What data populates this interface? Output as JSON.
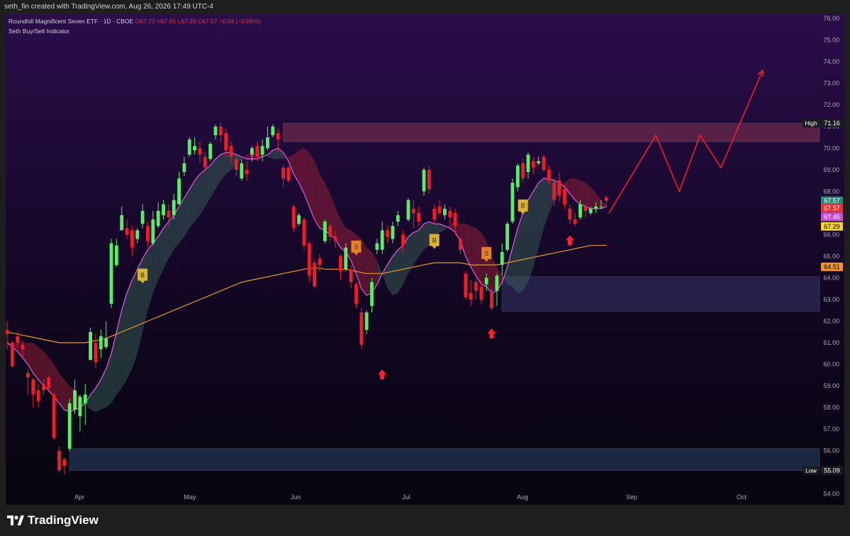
{
  "header": {
    "credit": "seth_fin created with TradingView.com, Aug 26, 2026 17:49 UTC-4"
  },
  "legend": {
    "symbol": "Roundhill Magnificent Seven ETF · 1D · CBOE",
    "ohlc": "O67.73  H67.81  L67.28  C67.57  −0.04 (−0.06%)",
    "indicator": "Seth Buy/Sell Indicator"
  },
  "branding": {
    "logo_text": "TradingView"
  },
  "colors": {
    "bg_top": "#2a0d4a",
    "bg_bottom": "#07060e",
    "up_candle": "#59ee6a",
    "down_candle": "#f01c2a",
    "ma_fast": "#e45ce2",
    "ma_slow": "#e59a2a",
    "projection": "#f01c2a",
    "buy_label": "#d9b23a",
    "sell_label": "#e3802a"
  },
  "chart_data": {
    "type": "candlestick",
    "title": "Roundhill Magnificent Seven ETF · 1D · CBOE",
    "ylim": [
      53.5,
      76.2
    ],
    "y_ticks": [
      "76.00",
      "75.00",
      "74.00",
      "73.00",
      "72.00",
      "71.00",
      "70.00",
      "69.00",
      "68.00",
      "67.00",
      "66.00",
      "65.00",
      "64.00",
      "63.00",
      "62.00",
      "61.00",
      "60.00",
      "59.00",
      "58.00",
      "57.00",
      "56.00",
      "55.00",
      "54.00"
    ],
    "x_labels": [
      "Apr",
      "May",
      "Jun",
      "Jul",
      "Aug",
      "Sep",
      "Oct"
    ],
    "price_tags": [
      {
        "label": "High",
        "value": "71.16",
        "price": 71.16,
        "bg": "#1b1b22",
        "fg": "#ffffff"
      },
      {
        "value": "67.57",
        "price": 67.57,
        "bg": "#2b8a7a",
        "fg": "#ffffff"
      },
      {
        "value": "67.57",
        "price": 67.22,
        "bg": "#e5323a",
        "fg": "#ffffff"
      },
      {
        "value": "67.45",
        "price": 66.82,
        "bg": "#c84fd0",
        "fg": "#ffffff"
      },
      {
        "value": "67.29",
        "price": 66.38,
        "bg": "#f2d33a",
        "fg": "#000000"
      },
      {
        "value": "64.51",
        "price": 64.51,
        "bg": "#f0952a",
        "fg": "#000000"
      },
      {
        "label": "Low",
        "value": "55.09",
        "price": 55.09,
        "bg": "#1b1b22",
        "fg": "#ffffff"
      }
    ],
    "candles": [
      [
        61.6,
        61.4,
        62.0,
        60.7
      ],
      [
        61.0,
        59.9,
        61.1,
        59.9
      ],
      [
        61.3,
        61.0,
        61.5,
        60.8
      ],
      [
        60.9,
        60.7,
        61.1,
        60.3
      ],
      [
        59.6,
        59.4,
        59.8,
        58.6
      ],
      [
        59.3,
        58.6,
        59.4,
        58.0
      ],
      [
        58.8,
        58.3,
        59.1,
        58.0
      ],
      [
        59.1,
        58.8,
        59.3,
        58.6
      ],
      [
        59.4,
        58.9,
        59.5,
        58.7
      ],
      [
        58.6,
        56.6,
        58.7,
        56.5
      ],
      [
        56.0,
        55.1,
        56.2,
        55.0
      ],
      [
        55.6,
        55.3,
        55.7,
        54.9
      ],
      [
        56.1,
        58.2,
        58.4,
        56.0
      ],
      [
        57.9,
        58.8,
        59.3,
        57.7
      ],
      [
        57.6,
        58.5,
        58.6,
        56.9
      ],
      [
        58.2,
        58.6,
        59.1,
        57.2
      ],
      [
        60.2,
        61.5,
        61.7,
        60.2
      ],
      [
        61.0,
        60.1,
        61.4,
        59.8
      ],
      [
        60.7,
        61.3,
        61.6,
        60.3
      ],
      [
        60.8,
        61.2,
        62.0,
        60.7
      ],
      [
        62.8,
        65.6,
        65.8,
        62.6
      ],
      [
        64.6,
        65.5,
        65.8,
        64.5
      ],
      [
        66.2,
        66.9,
        67.3,
        66.2
      ],
      [
        66.3,
        66.0,
        66.7,
        65.8
      ],
      [
        66.2,
        65.4,
        66.4,
        65.0
      ],
      [
        65.8,
        66.2,
        66.3,
        65.6
      ],
      [
        66.5,
        67.1,
        67.4,
        66.3
      ],
      [
        66.4,
        65.7,
        66.6,
        65.4
      ],
      [
        65.6,
        66.7,
        67.1,
        65.5
      ],
      [
        66.4,
        67.1,
        67.5,
        66.3
      ],
      [
        66.9,
        67.4,
        67.6,
        66.7
      ],
      [
        67.1,
        66.8,
        67.4,
        66.4
      ],
      [
        66.9,
        67.6,
        67.9,
        66.7
      ],
      [
        67.4,
        68.6,
        68.9,
        67.4
      ],
      [
        68.9,
        69.3,
        69.6,
        68.7
      ],
      [
        69.7,
        70.4,
        70.5,
        69.6
      ],
      [
        69.9,
        70.1,
        70.5,
        69.7
      ],
      [
        70.0,
        69.7,
        70.3,
        69.3
      ],
      [
        69.6,
        69.1,
        69.8,
        68.9
      ],
      [
        69.5,
        70.2,
        70.3,
        69.4
      ],
      [
        70.6,
        71.0,
        71.1,
        70.4
      ],
      [
        71.0,
        70.6,
        71.2,
        70.3
      ],
      [
        70.7,
        69.9,
        70.9,
        69.6
      ],
      [
        70.1,
        69.6,
        70.3,
        69.3
      ],
      [
        69.5,
        69.0,
        69.7,
        68.7
      ],
      [
        68.6,
        69.3,
        69.5,
        68.5
      ],
      [
        69.0,
        68.8,
        69.4,
        68.5
      ],
      [
        69.7,
        70.0,
        70.1,
        69.4
      ],
      [
        70.1,
        69.6,
        70.3,
        69.4
      ],
      [
        69.7,
        70.1,
        70.4,
        69.4
      ],
      [
        70.0,
        70.5,
        71.0,
        69.9
      ],
      [
        70.6,
        71.0,
        71.1,
        70.5
      ],
      [
        70.7,
        70.4,
        70.9,
        69.8
      ],
      [
        69.1,
        68.6,
        69.2,
        68.2
      ],
      [
        69.1,
        68.5,
        69.2,
        68.4
      ],
      [
        67.3,
        66.3,
        67.4,
        66.1
      ],
      [
        66.5,
        66.9,
        67.0,
        66.4
      ],
      [
        66.7,
        65.5,
        66.8,
        65.3
      ],
      [
        65.6,
        64.1,
        65.7,
        63.8
      ],
      [
        64.7,
        63.6,
        64.9,
        63.5
      ],
      [
        64.9,
        64.6,
        65.1,
        64.3
      ],
      [
        65.7,
        66.6,
        66.7,
        65.6
      ],
      [
        66.4,
        65.9,
        66.5,
        65.7
      ],
      [
        65.9,
        65.7,
        66.2,
        65.4
      ],
      [
        65.0,
        64.3,
        65.1,
        63.9
      ],
      [
        64.4,
        65.4,
        65.6,
        64.3
      ],
      [
        64.4,
        63.8,
        64.6,
        63.5
      ],
      [
        63.7,
        62.8,
        63.8,
        62.6
      ],
      [
        62.4,
        60.9,
        62.6,
        60.7
      ],
      [
        61.6,
        62.4,
        62.5,
        61.4
      ],
      [
        62.7,
        63.8,
        64.0,
        62.4
      ],
      [
        65.3,
        65.6,
        65.8,
        65.1
      ],
      [
        65.3,
        66.2,
        66.6,
        65.1
      ],
      [
        66.2,
        65.9,
        66.4,
        65.6
      ],
      [
        65.8,
        66.4,
        66.6,
        65.6
      ],
      [
        66.6,
        66.9,
        67.1,
        66.4
      ],
      [
        66.0,
        65.5,
        66.2,
        65.2
      ],
      [
        66.7,
        67.6,
        67.7,
        66.6
      ],
      [
        67.2,
        67.0,
        67.6,
        66.3
      ],
      [
        67.0,
        66.6,
        67.3,
        66.4
      ],
      [
        68.0,
        69.0,
        69.1,
        67.8
      ],
      [
        69.0,
        68.1,
        69.2,
        67.9
      ],
      [
        67.2,
        66.7,
        67.4,
        66.5
      ],
      [
        67.3,
        67.0,
        67.6,
        66.9
      ],
      [
        66.9,
        67.2,
        67.4,
        66.7
      ],
      [
        67.1,
        66.8,
        67.3,
        66.5
      ],
      [
        67.0,
        66.4,
        67.2,
        66.0
      ],
      [
        65.8,
        65.3,
        65.9,
        65.1
      ],
      [
        64.2,
        63.1,
        64.3,
        63.0
      ],
      [
        63.3,
        63.0,
        63.9,
        62.7
      ],
      [
        63.8,
        63.4,
        64.0,
        63.0
      ],
      [
        63.6,
        63.0,
        63.9,
        62.8
      ],
      [
        63.7,
        64.0,
        64.2,
        63.4
      ],
      [
        63.3,
        62.6,
        63.5,
        62.5
      ],
      [
        63.4,
        64.1,
        64.2,
        62.7
      ],
      [
        64.6,
        65.2,
        65.6,
        64.1
      ],
      [
        65.3,
        66.5,
        66.6,
        65.2
      ],
      [
        66.6,
        68.4,
        68.6,
        66.5
      ],
      [
        68.2,
        69.2,
        69.3,
        68.0
      ],
      [
        69.3,
        68.6,
        69.5,
        68.4
      ],
      [
        68.9,
        69.7,
        69.8,
        68.6
      ],
      [
        69.4,
        69.1,
        69.6,
        68.8
      ],
      [
        69.3,
        69.4,
        69.6,
        69.2
      ],
      [
        69.6,
        69.0,
        69.7,
        68.9
      ],
      [
        69.0,
        68.5,
        69.2,
        68.3
      ],
      [
        68.4,
        67.6,
        68.6,
        67.3
      ],
      [
        68.5,
        67.8,
        68.9,
        67.5
      ],
      [
        68.1,
        67.4,
        68.3,
        67.2
      ],
      [
        67.2,
        66.7,
        67.4,
        66.5
      ],
      [
        66.7,
        66.5,
        67.0,
        66.4
      ],
      [
        66.8,
        67.4,
        67.6,
        66.7
      ],
      [
        67.3,
        67.1,
        67.4,
        66.8
      ],
      [
        67.0,
        67.2,
        67.3,
        66.9
      ],
      [
        67.2,
        67.3,
        67.5,
        67.0
      ],
      [
        67.3,
        67.3,
        67.6,
        67.2
      ],
      [
        67.73,
        67.57,
        67.81,
        67.28
      ]
    ],
    "ma_fast": [
      61.0,
      60.8,
      60.6,
      60.3,
      60.0,
      59.6,
      59.3,
      59.0,
      58.8,
      58.5,
      58.2,
      57.9,
      57.8,
      57.9,
      58.0,
      58.2,
      58.6,
      58.9,
      59.3,
      59.8,
      60.5,
      61.5,
      62.5,
      63.3,
      63.9,
      64.4,
      64.9,
      65.3,
      65.6,
      65.9,
      66.3,
      66.6,
      66.9,
      67.3,
      67.7,
      68.1,
      68.5,
      68.8,
      69.0,
      69.2,
      69.5,
      69.7,
      69.8,
      69.8,
      69.7,
      69.6,
      69.5,
      69.5,
      69.5,
      69.6,
      69.7,
      69.9,
      70.0,
      69.8,
      69.4,
      68.8,
      68.4,
      67.9,
      67.3,
      66.7,
      66.3,
      66.2,
      66.0,
      65.8,
      65.4,
      65.2,
      64.8,
      64.2,
      63.5,
      63.2,
      63.3,
      63.7,
      64.2,
      64.6,
      65.0,
      65.3,
      65.5,
      65.9,
      66.1,
      66.2,
      66.5,
      66.6,
      66.5,
      66.5,
      66.4,
      66.3,
      66.1,
      65.7,
      65.0,
      64.5,
      64.1,
      63.7,
      63.6,
      63.3,
      63.4,
      63.8,
      64.5,
      65.4,
      66.3,
      67.0,
      67.6,
      68.0,
      68.4,
      68.6,
      68.6,
      68.5,
      68.4,
      68.2,
      67.9,
      67.6,
      67.4,
      67.3,
      67.2,
      67.2,
      67.2,
      67.3
    ],
    "ma_slow": [
      61.5,
      61.45,
      61.4,
      61.35,
      61.3,
      61.25,
      61.2,
      61.15,
      61.1,
      61.05,
      61.0,
      61.0,
      61.0,
      61.0,
      61.0,
      61.0,
      61.05,
      61.1,
      61.15,
      61.2,
      61.3,
      61.4,
      61.5,
      61.6,
      61.7,
      61.8,
      61.9,
      62.0,
      62.1,
      62.2,
      62.3,
      62.4,
      62.5,
      62.6,
      62.7,
      62.8,
      62.9,
      63.0,
      63.1,
      63.2,
      63.3,
      63.4,
      63.5,
      63.6,
      63.7,
      63.8,
      63.85,
      63.9,
      63.95,
      64.0,
      64.05,
      64.1,
      64.15,
      64.2,
      64.25,
      64.3,
      64.35,
      64.4,
      64.45,
      64.45,
      64.45,
      64.4,
      64.4,
      64.4,
      64.4,
      64.4,
      64.35,
      64.3,
      64.25,
      64.2,
      64.2,
      64.2,
      64.2,
      64.25,
      64.3,
      64.35,
      64.4,
      64.45,
      64.5,
      64.55,
      64.6,
      64.65,
      64.7,
      64.7,
      64.7,
      64.7,
      64.7,
      64.7,
      64.65,
      64.6,
      64.6,
      64.6,
      64.6,
      64.6,
      64.6,
      64.65,
      64.7,
      64.75,
      64.8,
      64.85,
      64.9,
      64.95,
      65.0,
      65.05,
      65.1,
      65.15,
      65.2,
      65.25,
      65.3,
      65.35,
      65.4,
      65.45,
      65.5,
      65.5,
      65.5,
      65.51
    ],
    "cloud": {
      "upper_offset": 0.9,
      "color_bull": "#3b6a5a",
      "color_bear": "#a8243a"
    },
    "zones": [
      {
        "name": "resistance-zone",
        "top": 71.16,
        "bottom": 70.3,
        "start": 53,
        "end": "edge",
        "color": "#6a2a4a"
      },
      {
        "name": "demand-zone",
        "top": 64.05,
        "bottom": 62.45,
        "start": 95,
        "end": "edge",
        "color": "#2c2a55"
      },
      {
        "name": "support-zone",
        "top": 56.1,
        "bottom": 55.09,
        "start": 12,
        "end": "edge",
        "color": "#233352"
      }
    ],
    "signals": [
      {
        "type": "B",
        "bar": 26,
        "price": 64.1
      },
      {
        "type": "S",
        "bar": 67,
        "price": 65.4
      },
      {
        "type": "B",
        "bar": 82,
        "price": 65.7
      },
      {
        "type": "S",
        "bar": 92,
        "price": 65.1
      },
      {
        "type": "B",
        "bar": 99,
        "price": 67.3
      }
    ],
    "arrows": [
      {
        "bar": 72,
        "price": 59.5
      },
      {
        "bar": 93,
        "price": 61.4
      },
      {
        "bar": 108,
        "price": 65.7
      }
    ],
    "projection": [
      [
        67.0,
        115.5
      ],
      [
        70.6,
        124.5
      ],
      [
        68.0,
        129
      ],
      [
        70.6,
        133
      ],
      [
        69.1,
        137
      ],
      [
        73.6,
        145
      ]
    ]
  }
}
